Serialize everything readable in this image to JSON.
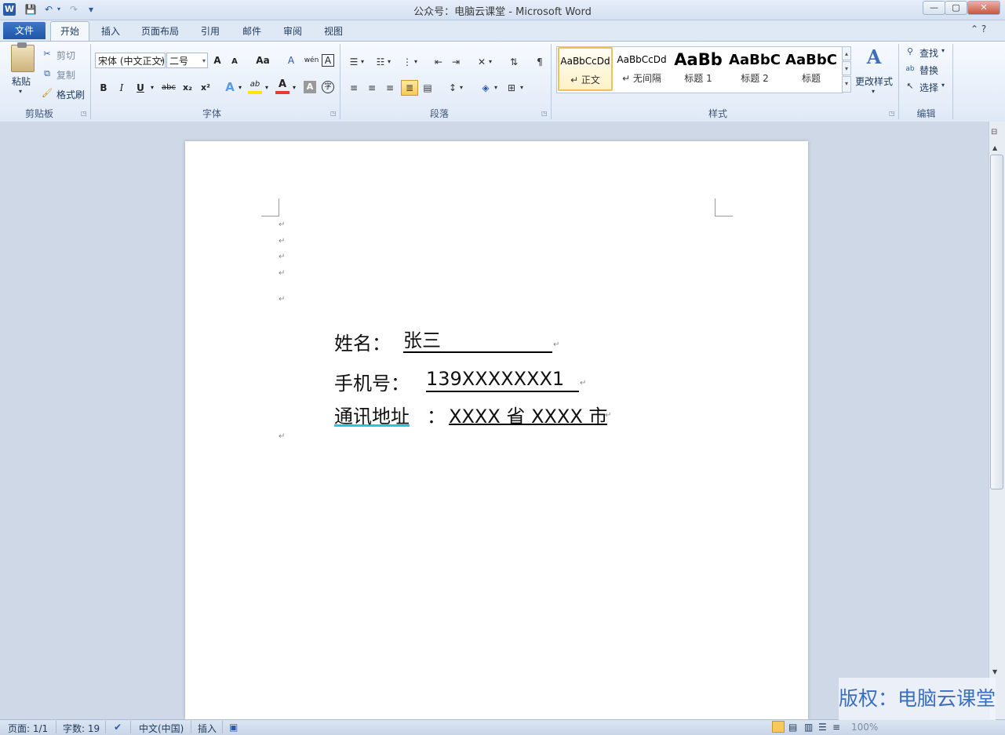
{
  "window": {
    "title": "公众号：电脑云课堂 - Microsoft Word",
    "app_icon": "W",
    "controls": [
      "—",
      "▢",
      "✕"
    ]
  },
  "quick_access": {
    "save_icon": "💾",
    "undo_icon": "↶",
    "redo_icon": "↷",
    "customize_icon": "▾"
  },
  "tabs": {
    "file": "文件",
    "home": "开始",
    "insert": "插入",
    "page_layout": "页面布局",
    "references": "引用",
    "mailings": "邮件",
    "review": "审阅",
    "view": "视图",
    "help": "⌃ ?"
  },
  "clipboard": {
    "paste": "粘贴",
    "cut": "剪切",
    "copy": "复制",
    "format_painter": "格式刷",
    "label": "剪贴板"
  },
  "font": {
    "font_name": "宋体 (中文正文)",
    "font_size": "二号",
    "grow": "A",
    "shrink": "A",
    "change_case": "Aa",
    "clear": "A",
    "phonetic": "wén",
    "border": "A",
    "bold": "B",
    "italic": "I",
    "underline": "U",
    "strikethrough": "abc",
    "subscript": "x₂",
    "superscript": "x²",
    "text_effects": "A",
    "highlight": "ab",
    "font_color": "A",
    "shading": "A",
    "enclose": "字",
    "label": "字体"
  },
  "paragraph": {
    "label": "段落"
  },
  "styles": {
    "items": [
      {
        "sample": "AaBbCcDd",
        "name": "↵ 正文"
      },
      {
        "sample": "AaBbCcDd",
        "name": "↵ 无间隔"
      },
      {
        "sample": "AaBb",
        "name": "标题 1"
      },
      {
        "sample": "AaBbC",
        "name": "标题 2"
      },
      {
        "sample": "AaBbC",
        "name": "标题"
      }
    ],
    "change_styles": "更改样式",
    "label": "样式"
  },
  "editing": {
    "find": "查找",
    "replace": "替换",
    "select": "选择",
    "label": "编辑"
  },
  "document": {
    "name_label": "姓名：",
    "name_value": "张三",
    "phone_label": "手机号：",
    "phone_value": "139XXXXXXX1",
    "address_label": "通讯地址",
    "address_colon": "：",
    "address_value": "XXXX 省 XXXX 市",
    "para_mark": "↵"
  },
  "status": {
    "page": "页面: 1/1",
    "words": "字数: 19",
    "language": "中文(中国)",
    "mode": "插入",
    "zoom": "100%"
  },
  "watermark": "版权：电脑云课堂"
}
